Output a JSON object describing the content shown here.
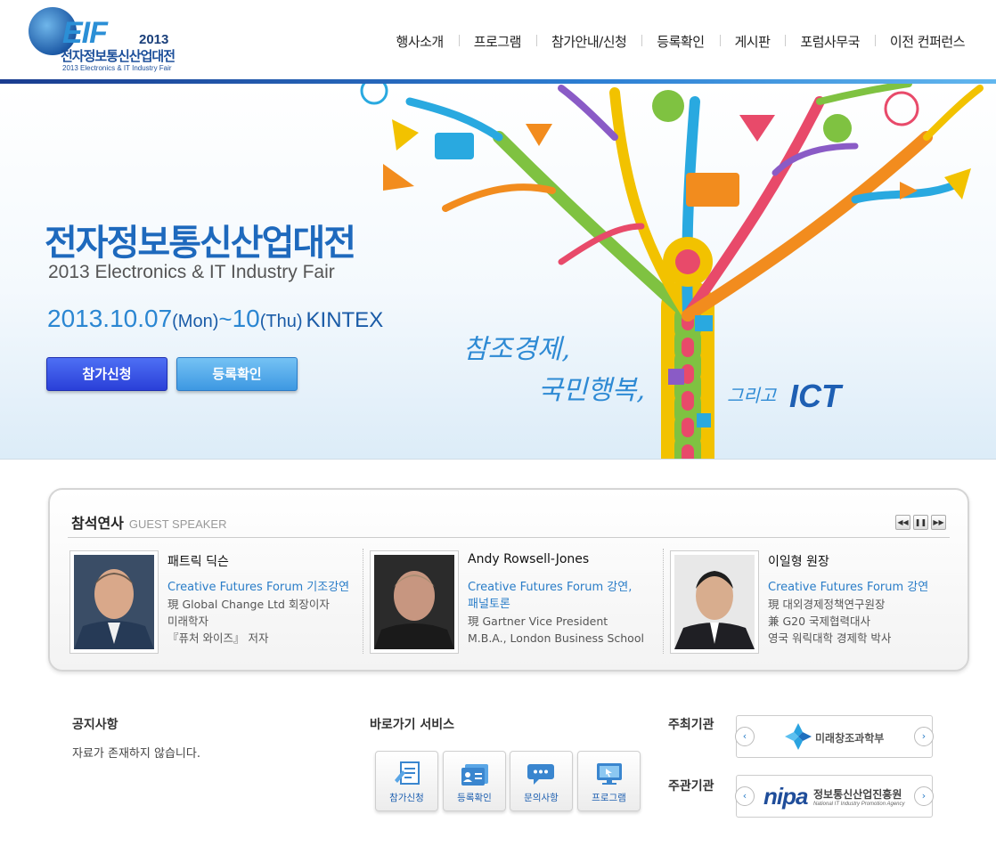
{
  "header": {
    "logo": {
      "main": "EIF",
      "year": "2013",
      "korean": "전자정보통신산업대전",
      "english": "2013 Electronics & IT Industry Fair"
    },
    "nav": [
      {
        "label": "행사소개"
      },
      {
        "label": "프로그램"
      },
      {
        "label": "참가안내/신청"
      },
      {
        "label": "등록확인"
      },
      {
        "label": "게시판"
      },
      {
        "label": "포럼사무국"
      },
      {
        "label": "이전 컨퍼런스"
      }
    ]
  },
  "hero": {
    "title": "전자정보통신산업대전",
    "subtitle": "2013 Electronics & IT Industry Fair",
    "date_start": "2013.10.07",
    "day_start": "(Mon)",
    "tilde": "~",
    "date_end": "10",
    "day_end": "(Thu)",
    "venue": "KINTEX",
    "apply_button": "참가신청",
    "check_button": "등록확인",
    "slogan": {
      "line1": "참조경제,",
      "line2": "국민행복,",
      "line3": "그리고",
      "line4": "ICT"
    }
  },
  "speakers": {
    "title": "참석연사",
    "title_en": "GUEST SPEAKER",
    "controls": {
      "prev": "◀◀",
      "pause": "❚❚",
      "next": "▶▶"
    },
    "items": [
      {
        "name": "패트릭 딕슨",
        "role": [
          "Creative Futures Forum 기조강연"
        ],
        "desc": [
          "現 Global Change Ltd 회장이자",
          "미래학자",
          "『퓨처 와이즈』 저자"
        ]
      },
      {
        "name": "Andy Rowsell-Jones",
        "role": [
          "Creative Futures Forum 강연,",
          "패널토론"
        ],
        "desc": [
          "現 Gartner Vice President",
          "M.B.A., London Business School"
        ]
      },
      {
        "name": "이일형 원장",
        "role": [
          "Creative Futures Forum 강연"
        ],
        "desc": [
          "現 대외경제정책연구원장",
          "兼 G20 국제협력대사",
          "영국 워릭대학 경제학 박사"
        ]
      }
    ]
  },
  "notice": {
    "title": "공지사항",
    "empty": "자료가 존재하지 않습니다."
  },
  "quick": {
    "title": "바로가기 서비스",
    "items": [
      {
        "label": "참가신청",
        "icon": "apply-document-icon"
      },
      {
        "label": "등록확인",
        "icon": "registration-card-icon"
      },
      {
        "label": "문의사항",
        "icon": "chat-bubble-icon"
      },
      {
        "label": "프로그램",
        "icon": "monitor-icon"
      }
    ]
  },
  "organizers": {
    "host_label": "주최기관",
    "host_name": "미래창조과학부",
    "organizer_label": "주관기관",
    "organizer_logo": "nipa",
    "organizer_name": "정보통신산업진흥원",
    "organizer_name_en": "National IT Industry Promotion Agency",
    "arrow_left": "‹",
    "arrow_right": "›"
  },
  "colors": {
    "accent": "#1e69bd",
    "nav_bar": "#2d7fd3",
    "apply_button": "#2a3fd8",
    "check_button": "#3d98e2"
  }
}
